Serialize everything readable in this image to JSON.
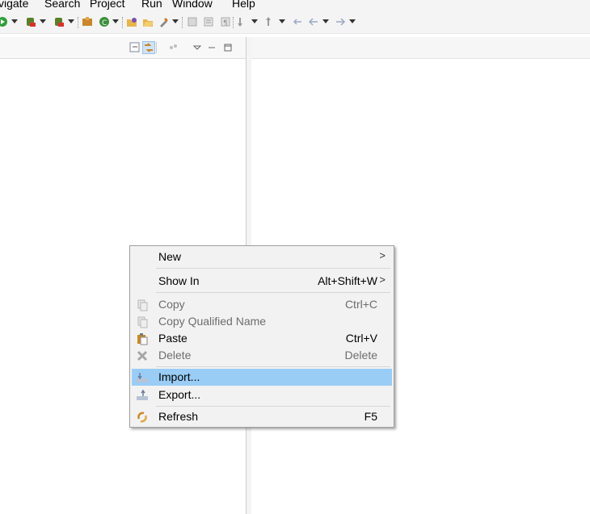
{
  "menubar": {
    "items": [
      "vigate",
      "Search",
      "Project",
      "Run",
      "Window",
      "Help"
    ]
  },
  "toolbar": {
    "icons": [
      "run-icon",
      "debug-icon",
      "coverage-icon",
      "new-java-project-icon",
      "new-class-icon",
      "open-type-icon",
      "open-folder-icon",
      "search-icon",
      "pin-icon",
      "annotation-icon",
      "back-icon",
      "forward-icon"
    ]
  },
  "context_menu": {
    "items": [
      {
        "label": "New",
        "shortcut": "",
        "submenu": ">",
        "icon": "",
        "enabled": true
      },
      {
        "label": "Show In",
        "shortcut": "Alt+Shift+W",
        "submenu": ">",
        "icon": "",
        "enabled": true
      },
      {
        "label": "Copy",
        "shortcut": "Ctrl+C",
        "submenu": "",
        "icon": "copy-icon",
        "enabled": false
      },
      {
        "label": "Copy Qualified Name",
        "shortcut": "",
        "submenu": "",
        "icon": "copy-qualified-name-icon",
        "enabled": false
      },
      {
        "label": "Paste",
        "shortcut": "Ctrl+V",
        "submenu": "",
        "icon": "paste-icon",
        "enabled": true
      },
      {
        "label": "Delete",
        "shortcut": "Delete",
        "submenu": "",
        "icon": "delete-icon",
        "enabled": false
      },
      {
        "label": "Import...",
        "shortcut": "",
        "submenu": "",
        "icon": "import-icon",
        "enabled": true,
        "highlighted": true
      },
      {
        "label": "Export...",
        "shortcut": "",
        "submenu": "",
        "icon": "export-icon",
        "enabled": true
      },
      {
        "label": "Refresh",
        "shortcut": "F5",
        "submenu": "",
        "icon": "refresh-icon",
        "enabled": true
      }
    ]
  },
  "colors": {
    "highlight": "#99cdf6",
    "menu_bg": "#f2f2f2",
    "disabled_text": "#6d6d6d"
  }
}
